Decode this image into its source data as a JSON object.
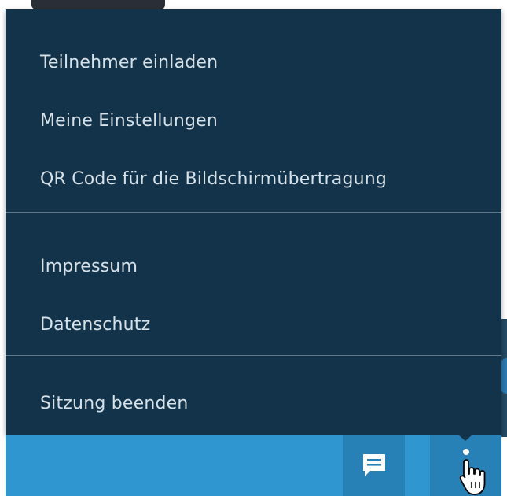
{
  "menu": {
    "items": [
      {
        "label": "Teilnehmer einladen"
      },
      {
        "label": "Meine Einstellungen"
      },
      {
        "label": "QR Code für die Bildschirmübertragung"
      },
      {
        "label": "Impressum"
      },
      {
        "label": "Datenschutz"
      },
      {
        "label": "Sitzung beenden"
      }
    ]
  },
  "toolbar": {
    "chat_icon": "chat-bubble-icon",
    "more_icon": "more-vertical-icon"
  },
  "colors": {
    "menu_background": "#12334a",
    "menu_text": "#d7e1e8",
    "toolbar_background": "#2f96cf",
    "toolbar_button": "#2780b6"
  }
}
